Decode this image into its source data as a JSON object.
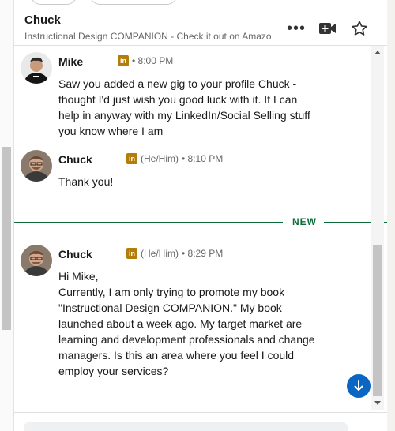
{
  "header": {
    "name": "Chuck",
    "subtitle": "Instructional Design COMPANION - Check it out on Amazon",
    "more_icon": "more-horizontal-icon",
    "video_icon": "video-add-icon",
    "star_icon": "star-outline-icon"
  },
  "messages": [
    {
      "sender": "Mike",
      "pronouns": "",
      "time": "• 8:00 PM",
      "text": "Saw you added a new gig to your profile Chuck -\nthought I'd just wish you good luck with it. If I can\nhelp in anyway with my LinkedIn/Social Selling stuff\nyou know where I am"
    },
    {
      "sender": "Chuck",
      "pronouns": "(He/Him)",
      "time": "• 8:10 PM",
      "text": "Thank you!"
    },
    {
      "sender": "Chuck",
      "pronouns": "(He/Him)",
      "time": "• 8:29 PM",
      "text": "Hi Mike,\nCurrently, I am only trying to promote my book\n\"Instructional Design COMPANION.\" My book\nlaunched about a week ago. My target market are\nlearning and development professionals and change\nmanagers. Is this an area where you feel I could\nemploy your services?"
    }
  ],
  "divider": {
    "label": "NEW"
  },
  "linkedin_badge": "in",
  "colors": {
    "accent": "#0a66c2",
    "new_divider": "#0a6b38",
    "li_badge": "#b37d0a"
  }
}
